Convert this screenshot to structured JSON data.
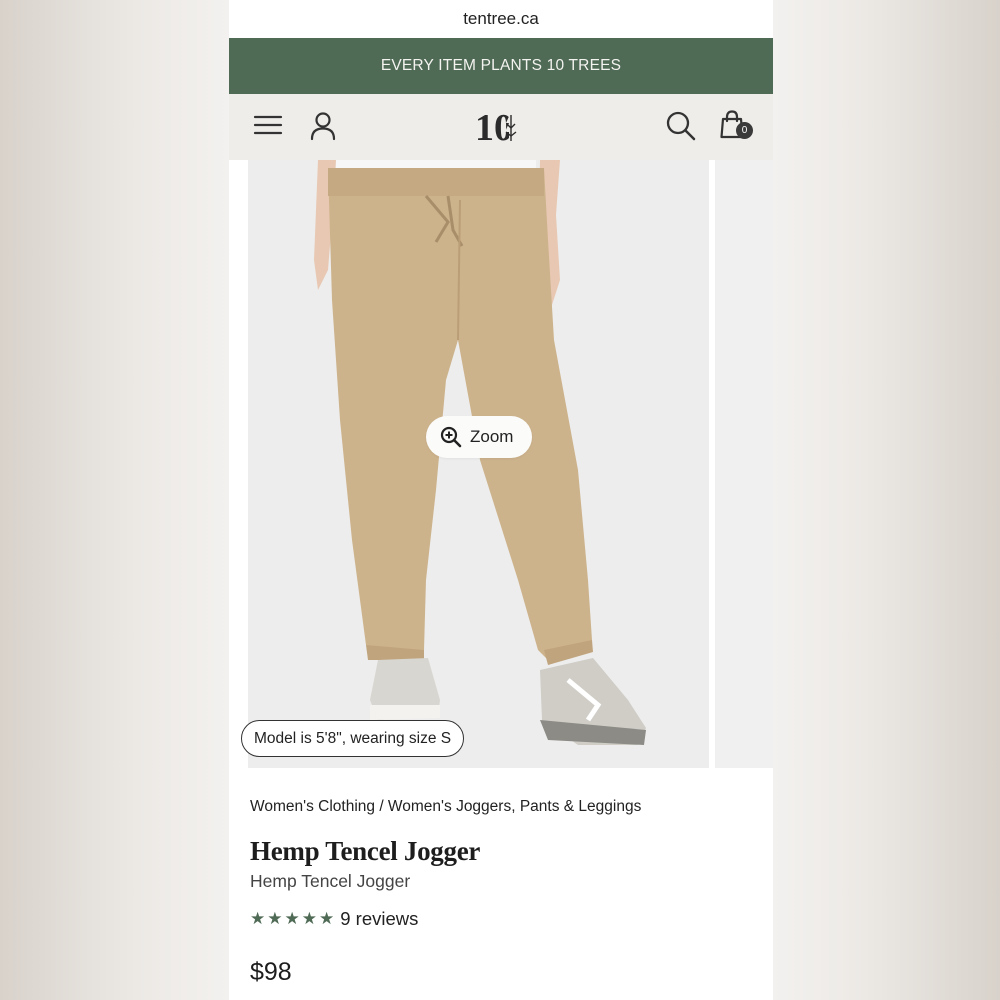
{
  "browser": {
    "url": "tentree.ca"
  },
  "promo": {
    "text": "EVERY ITEM PLANTS 10 TREES"
  },
  "header": {
    "logo": "10",
    "cart_count": "0",
    "icons": [
      "menu-icon",
      "user-icon",
      "search-icon",
      "shopping-bag-icon"
    ]
  },
  "gallery": {
    "zoom_label": "Zoom",
    "model_note": "Model is 5'8\", wearing size S"
  },
  "product": {
    "breadcrumb": "Women's Clothing / Women's Joggers, Pants & Leggings",
    "title": "Hemp Tencel Jogger",
    "subtitle": "Hemp Tencel Jogger",
    "rating": 5,
    "reviews": "9 reviews",
    "price": "$98"
  },
  "colors": {
    "promo_bg": "#4f6a55",
    "header_bg": "#efede9",
    "star": "#4f6a55",
    "pants": "#cdb38c"
  }
}
